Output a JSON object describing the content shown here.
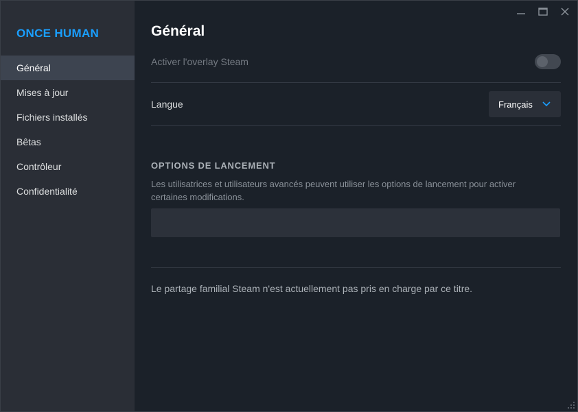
{
  "app": {
    "title": "ONCE HUMAN"
  },
  "window_controls": {
    "minimize_icon": "minimize-icon",
    "maximize_icon": "maximize-icon",
    "close_icon": "close-icon"
  },
  "sidebar": {
    "items": [
      {
        "label": "Général",
        "active": true
      },
      {
        "label": "Mises à jour",
        "active": false
      },
      {
        "label": "Fichiers installés",
        "active": false
      },
      {
        "label": "Bêtas",
        "active": false
      },
      {
        "label": "Contrôleur",
        "active": false
      },
      {
        "label": "Confidentialité",
        "active": false
      }
    ]
  },
  "main": {
    "title": "Général",
    "overlay": {
      "label": "Activer l'overlay Steam",
      "enabled": false
    },
    "language": {
      "label": "Langue",
      "selected": "Français"
    },
    "launch_options": {
      "title": "OPTIONS DE LANCEMENT",
      "description": "Les utilisatrices et utilisateurs avancés peuvent utiliser les options de lancement pour activer certaines modifications.",
      "value": ""
    },
    "family_sharing_note": "Le partage familial Steam n'est actuellement pas pris en charge par ce titre."
  },
  "colors": {
    "accent": "#1a9fff",
    "sidebar_bg": "#2a2e36",
    "main_bg": "#1b2129",
    "active_item_bg": "#3d4450"
  }
}
